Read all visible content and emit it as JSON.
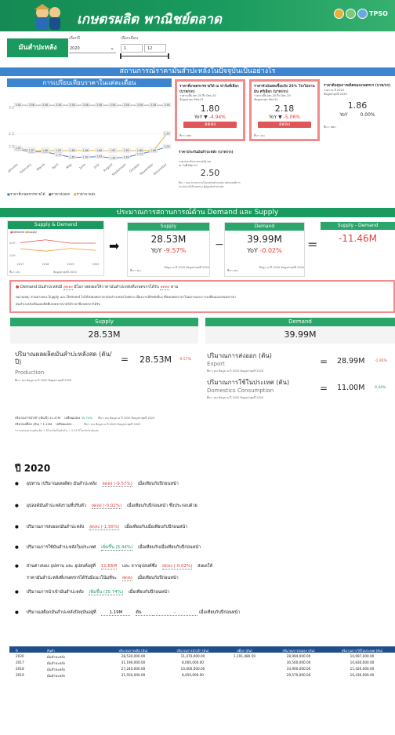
{
  "header": {
    "title": "เกษตรผลิต พาณิชย์ตลาด",
    "brand": "TPSO"
  },
  "filters": {
    "product_label": "มันสำปะหลัง",
    "year_label": "เลือกปี",
    "year_value": "2020",
    "month_label": "เลือกเดือน",
    "month_from": "1",
    "month_to": "12"
  },
  "sec1": {
    "title": "สถานการณ์ราคามันสำปะหลังในปัจจุบันเป็นอย่างไร"
  },
  "price_chart": {
    "title": "การเปรียบเทียบราคาในแต่ละเดือน",
    "legend": [
      "ราคาที่เกษตรกรขายได้",
      "ราคาส่งออก",
      "ราคาขายส่ง"
    ]
  },
  "chart_data": {
    "type": "line",
    "categories": [
      "January",
      "February",
      "March",
      "April",
      "May",
      "June",
      "July",
      "August",
      "September",
      "October",
      "November",
      "December"
    ],
    "series": [
      {
        "name": "ราคาที่เกษตรกรขายได้",
        "values": [
          1.9,
          1.81,
          1.81,
          1.7,
          1.6,
          1.61,
          1.63,
          1.58,
          1.6,
          1.73,
          1.84,
          2.0
        ]
      },
      {
        "name": "ราคาส่งออก",
        "values": [
          3.58,
          3.58,
          3.58,
          3.58,
          3.58,
          3.58,
          3.58,
          3.58,
          3.58,
          3.58,
          3.58,
          3.58
        ]
      },
      {
        "name": "ราคาขายส่ง",
        "values": [
          1.95,
          1.87,
          1.86,
          1.85,
          1.86,
          1.86,
          1.86,
          1.85,
          1.85,
          1.86,
          1.86,
          2.5
        ]
      }
    ],
    "ylim": [
      1.5,
      4
    ],
    "yticks": [
      "3.5",
      "2.5",
      "2.0"
    ],
    "data_labels": [
      [
        "1.90",
        "1.81",
        "1.81",
        "1.70",
        "1.60",
        "1.61",
        "1.63",
        "1.58",
        "1.60",
        "1.73",
        "1.84",
        "2.00"
      ],
      [
        "3.58",
        "3.58",
        "3.58",
        "3.58",
        "3.58",
        "3.58",
        "3.58",
        "3.58",
        "3.58",
        "3.58",
        "3.58",
        "3.58"
      ],
      [
        "1.95",
        "1.87",
        "1.86",
        "1.85",
        "1.86",
        "1.86",
        "1.86",
        "1.85",
        "1.85",
        "1.86",
        "1.86",
        "2.50"
      ]
    ]
  },
  "price_cards": [
    {
      "title": "ราคาที่เกษตรกรขายได้ ณ ฟาร์มที่เลือก (บาท/กก)",
      "sub": "ราคาเฉลี่ย Jan-20 ถึง Dec-20",
      "sub2": "ข้อมูลล่าสุด Mar-21",
      "value": "1.80",
      "yoy_label": "YoY ▼",
      "yoy": "-4.94%",
      "btn": "ลดลง",
      "source": "ที่มา: สศก."
    },
    {
      "title": "ราคาหัวมันสดเชื้อแป้ง 25% โรงโม่ลานมัน ตรีเลือก (บาท/กก)",
      "sub": "ราคาเฉลี่ย Jan-20 ถึง Dec-20",
      "sub2": "ข้อมูลล่าสุด Mar-21",
      "value": "2.18",
      "yoy_label": "YoY ▼",
      "yoy": "-5.06%",
      "btn": "ลดลง",
      "source": "ที่มา: คน"
    },
    {
      "title": "ราคาต้นทุนการผลิตของเกษตรกร (บาท/กก)",
      "sub": "ราคา ณ ปี 2020",
      "sub2": "ข้อมูลล่าสุดปี 2020",
      "value": "1.86",
      "yoy_label": "YoY",
      "yoy": "0.00%",
      "source": "ที่มา: สศก."
    },
    {
      "title": "ราคาประกันมันสำปะหลัง (บาท/กก)",
      "sub": "ราคาประกันจากภาครัฐ คน",
      "sub2": "ณ วันที่ Mar-21",
      "value": "2.50",
      "note": "ที่มา : คณะกรรมการนโยบายมันสำปะหลัง หลักเกณฑ์การประกันรายได้เกษตรกร ผู้ปลูกมันสำปะหลัง"
    }
  ],
  "sec2": {
    "title": "ประมาณการสถานการณ์ด้าน Demand และ Supply"
  },
  "sd": {
    "chart_title": "Supply & Demand",
    "legend": [
      "Demand",
      "Supply"
    ],
    "years": [
      "2017",
      "2018",
      "2019",
      "2020"
    ],
    "yticks": [
      "40M",
      "20M"
    ],
    "source": "ที่มา: คน",
    "date": "ข้อมูลล่าสุดปี 2020",
    "supply_title": "Supply",
    "supply_value": "28.53M",
    "supply_yoy_label": "YoY",
    "supply_yoy": "-9.57%",
    "demand_title": "Demand",
    "demand_value": "39.99M",
    "demand_yoy_label": "YoY",
    "demand_yoy": "-0.02%",
    "diff_title": "Supply - Demand",
    "diff_value": "-11.46M",
    "card_src": "ที่มา: คน",
    "card_date": "ข้อมูล ณ ปี 2020 ข้อมูลล่าสุดปี 2020",
    "minus": "−",
    "equals": "="
  },
  "note": {
    "line1_a": "Demand มันสำปะหลังมี",
    "line1_pill": "ลดลง",
    "line1_b": "มีโอกาสส่งผลให้ราคามันสำปะหลังที่เกษตรกรได้รับ",
    "line1_pill2": "ลดลง",
    "line1_c": "ตาม",
    "line2": "หมายเหตุ: ส่วนต่างของ Supply และ Demand ไม่ได้ส่งผลต่อราคามันสำปะหลังโดยตรง เนื่องจากมีปัจจัยอื่นๆ ที่ส่งผลต่อราคาในตลาดและการเปลี่ยนแปลงของราคา",
    "line3": "มันสำปะหลังเป็นผลผลิตที่เกษตรกรขายได้ราคาที่เกษตรกรได้รับ"
  },
  "stats": {
    "supply_bar": "Supply",
    "demand_bar": "Demand",
    "supply_value": "28.53M",
    "demand_value": "39.99M",
    "prod_title": "ปริมาณผลผลิตมันสำปะหลังสด (ตัน/ปี)",
    "prod_en": "Production",
    "prod_src": "ที่มา: คน  ข้อมูล ณ ปี 2020  ข้อมูลล่าสุดปี 2020",
    "prod_value": "28.53M",
    "prod_yoy": "-9.57%",
    "export_title": "ปริมาณการส่งออก (ตัน)",
    "export_en": "Export",
    "export_src": "ที่มา: คน  ข้อมูล ณ ปี 2020  ข้อมูลล่าสุดปี 2020",
    "export_value": "28.99M",
    "export_yoy": "-1.95%",
    "dom_title": "ปริมาณการใช้ในประเทศ (ตัน)",
    "dom_en": "Domestics Consumption",
    "dom_src": "ที่มา: คน  ข้อมูล ณ ปี 2020  ข้อมูลล่าสุดปี 2020",
    "dom_value": "11.00M",
    "dom_yoy": "9.44%",
    "eq": "=",
    "imp_a": "ปริมาณการนำเข้า (ตัน/ปี) 11.47M",
    "imp_b": "เปลี่ยนแปลง",
    "imp_c": "35.74%",
    "imp_src": "ที่มา: คน  ข้อมูล ณ ปี 2020 ข้อมูลล่าสุดปี 2020",
    "stk_a": "ปริมาณสต็อก (ตัน) *  1.19M",
    "stk_b": "เปลี่ยนแปลง  -",
    "stk_src": "ที่มา: คน  ข้อมูล ณ ปี 2020  ข้อมูลล่าสุดปี 2020",
    "conv": "*การแปลงหน่วยมันเส้น 1 กิโลกรัมเป็นหัวมัน = 2.25 กิโลกรัมหัวมันสด"
  },
  "summary": {
    "year": "ปี 2020",
    "items": [
      {
        "a": "อุปทาน (ปริมาณผลผลิต) มันสำปะหลัง",
        "v": "ลดลง (-9.57%)",
        "b": "เมื่อเทียบกับปีก่อนหน้า",
        "color": "#e04040"
      },
      {
        "a": "อุปสงค์มันสำปะหลังรวมที่ปรับตัว",
        "v": "ลดลง (-0.02%)",
        "b": "เมื่อเทียบกับปีก่อนหน้า ซึ่งประกอบด้วย",
        "color": "#e04040"
      },
      {
        "a": "ปริมาณการส่งออกมันสำปะหลัง",
        "v": "ลดลง (-1.95%)",
        "b": "เมื่อเทียบกับเมื่อเทียบกับปีก่อนหน้า",
        "color": "#e04040"
      },
      {
        "a": "ปริมาณการใช้มันสำปะหลังในประเทศ",
        "v": "เพิ่มขึ้น (5.44%)",
        "b": "เมื่อเทียบกับเมื่อเทียบกับปีก่อนหน้า",
        "color": "#1a9a5e"
      }
    ],
    "gap_a": "ส่วนต่างของ อุปทาน และ อุปสงค์อยู่ที่",
    "gap_v": "11.66M",
    "gap_b": "และ จากอุปสงค์ซึ่ง",
    "gap_v2": "ลดลง (-0.02%)",
    "gap_c": "ส่งผลให้",
    "gap2_a": "ราคามันสำปะหลังที่เกษตรกรได้รับมีแนวโน้มที่จะ",
    "gap2_v": "ลดลง",
    "gap2_b": "เมื่อเทียบกับปีก่อนหน้า",
    "imp_a": "ปริมาณการนำเข้ามันสำปะหลัง",
    "imp_v": "เพิ่มขึ้น (35.74%)",
    "imp_b": "เมื่อเทียบกับปีก่อนหน้า",
    "stk_a": "ปริมาณสต็อกมันสำปะหลังปัจจุบันอยู่ที่",
    "stk_v": "1.19M",
    "stk_u": "ตัน",
    "stk_v2": "-",
    "stk_b": "เมื่อเทียบกับปีก่อนหน้า"
  },
  "table": {
    "headers": [
      "ปี",
      "สินค้า",
      "ปริมาณการผลิต (ตัน)",
      "ปริมาณการนำเข้า (ตัน)",
      "สต็อก (ตัน)",
      "ปริมาณการส่งออก (ตัน)",
      "ปริมาณการใช้ในประเทศ (ตัน)"
    ],
    "rows": [
      [
        "2020",
        "มันสำปะหลัง",
        "28,530,000.00",
        "11,470,000.00",
        "1,191,480.59",
        "28,994,000.00",
        "10,997,000.00"
      ],
      [
        "2017",
        "มันสำปะหลัง",
        "31,190,000.00",
        "8,000,000.00",
        "",
        "30,500,000.00",
        "10,830,000.00"
      ],
      [
        "2018",
        "มันสำปะหลัง",
        "27,240,000.00",
        "10,000,000.00",
        "",
        "33,900,000.00",
        "11,420,000.00"
      ],
      [
        "2019",
        "มันสำปะหลัง",
        "31,550,000.00",
        "8,450,000.00",
        "",
        "29,570,000.00",
        "10,430,000.00"
      ]
    ]
  },
  "colors": {
    "green": "#1a9a5e",
    "blue": "#3d86cf",
    "red": "#e04040",
    "pink": "#f28b8b"
  }
}
